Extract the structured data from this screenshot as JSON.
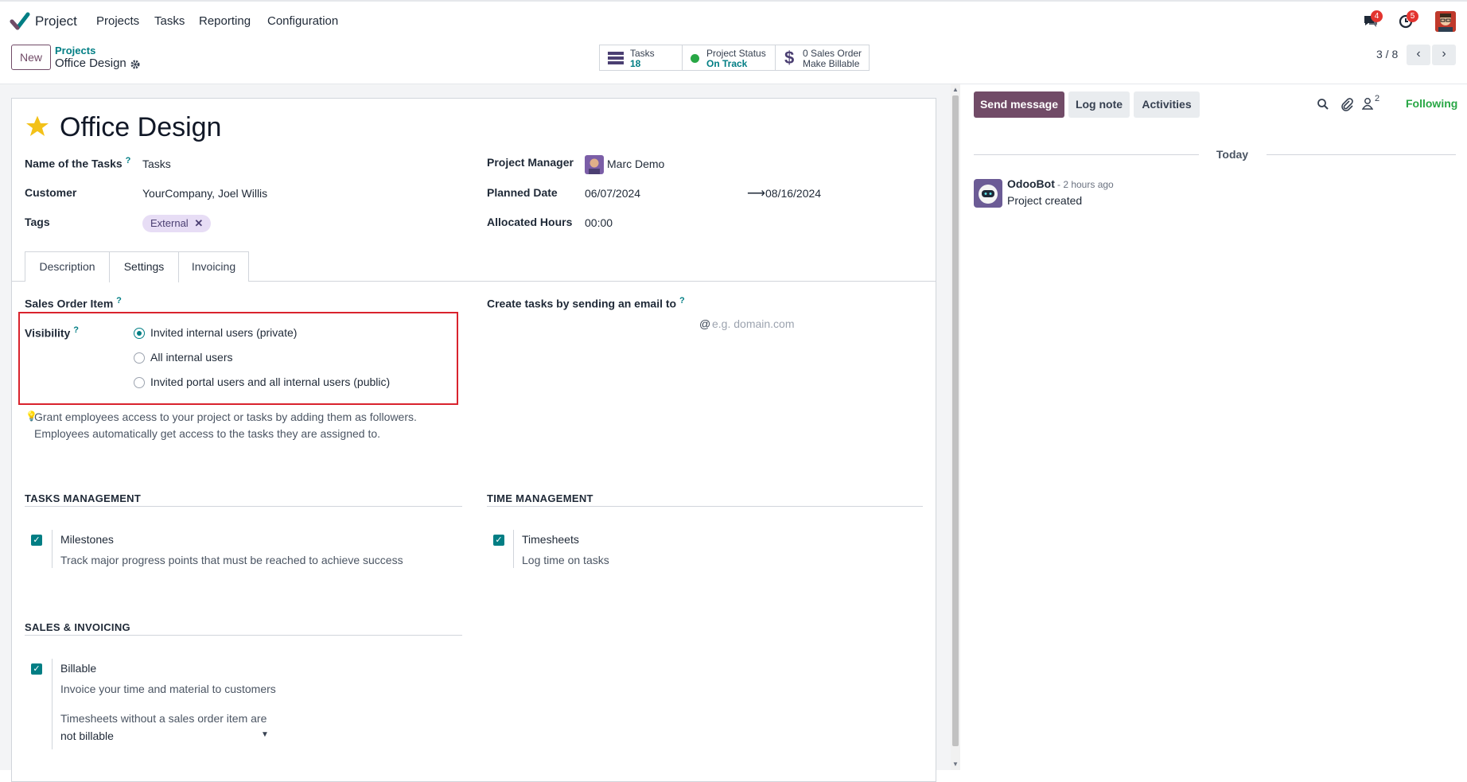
{
  "nav": {
    "app_name": "Project",
    "menu": [
      "Projects",
      "Tasks",
      "Reporting",
      "Configuration"
    ],
    "messages_badge": "4",
    "activities_badge": "5"
  },
  "control": {
    "new_label": "New",
    "breadcrumb_parent": "Projects",
    "breadcrumb_current": "Office Design",
    "smart_buttons": [
      {
        "line1": "Tasks",
        "line2": "18"
      },
      {
        "line1": "Project Status",
        "line2": "On Track"
      },
      {
        "line1": "0 Sales Order",
        "line2": "Make Billable"
      }
    ],
    "pager": "3 / 8"
  },
  "form": {
    "title": "Office Design",
    "fields_left": [
      {
        "label": "Name of the Tasks",
        "value": "Tasks",
        "help": true
      },
      {
        "label": "Customer",
        "value": "YourCompany, Joel Willis",
        "help": false
      },
      {
        "label": "Tags",
        "value": "",
        "help": false
      }
    ],
    "tag": "External",
    "fields_right": {
      "project_manager_label": "Project Manager",
      "project_manager_value": "Marc Demo",
      "planned_date_label": "Planned Date",
      "planned_start": "06/07/2024",
      "planned_end": "08/16/2024",
      "allocated_hours_label": "Allocated Hours",
      "allocated_hours_value": "00:00"
    },
    "tabs": [
      "Description",
      "Settings",
      "Invoicing"
    ],
    "active_tab": "Settings",
    "settings": {
      "sales_order_item_label": "Sales Order Item",
      "visibility_label": "Visibility",
      "visibility_options": [
        "Invited internal users (private)",
        "All internal users",
        "Invited portal users and all internal users (public)"
      ],
      "visibility_selected": 0,
      "hint_line1": "Grant employees access to your project or tasks by adding them as followers.",
      "hint_line2": "Employees automatically get access to the tasks they are assigned to.",
      "email_label": "Create tasks by sending an email to",
      "email_placeholder": "e.g. domain.com",
      "tasks_management_heading": "TASKS MANAGEMENT",
      "milestones_label": "Milestones",
      "milestones_desc": "Track major progress points that must be reached to achieve success",
      "time_management_heading": "TIME MANAGEMENT",
      "timesheets_label": "Timesheets",
      "timesheets_desc": "Log time on tasks",
      "sales_invoicing_heading": "SALES & INVOICING",
      "billable_label": "Billable",
      "billable_desc": "Invoice your time and material to customers",
      "timesheets_without_so": "Timesheets without a sales order item are",
      "not_billable_value": "not billable"
    }
  },
  "chatter": {
    "send_message": "Send message",
    "log_note": "Log note",
    "activities": "Activities",
    "followers_count": "2",
    "following": "Following",
    "date_separator": "Today",
    "author": "OdooBot",
    "time": "- 2 hours ago",
    "body": "Project created"
  },
  "colors": {
    "brand": "#714b67",
    "accent": "#017e84",
    "highlight_box": "#d9232d",
    "star": "#f3c118",
    "status_green": "#28a745"
  }
}
